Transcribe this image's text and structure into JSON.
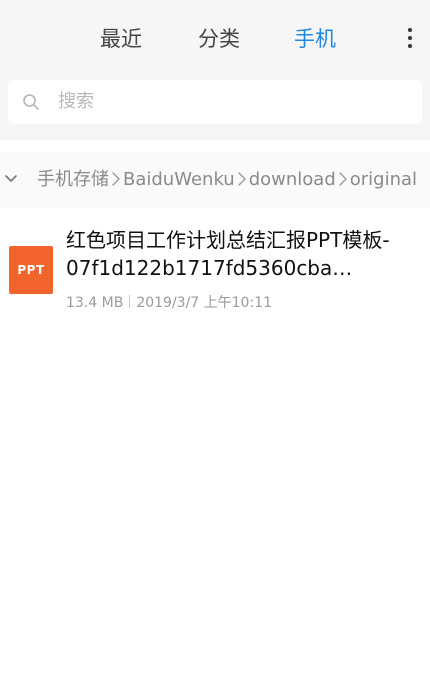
{
  "tabs": {
    "recent": "最近",
    "category": "分类",
    "phone": "手机"
  },
  "search": {
    "placeholder": "搜索"
  },
  "breadcrumb": {
    "items": [
      "手机存储",
      "BaiduWenku",
      "download",
      "original"
    ]
  },
  "file": {
    "icon_label": "PPT",
    "name": "红色项目工作计划总结汇报PPT模板-07f1d122b1717fd5360cba…",
    "size": "13.4 MB",
    "date": "2019/3/7 上午10:11"
  },
  "colors": {
    "accent": "#1e88e5",
    "ppt_icon": "#f2642b"
  }
}
